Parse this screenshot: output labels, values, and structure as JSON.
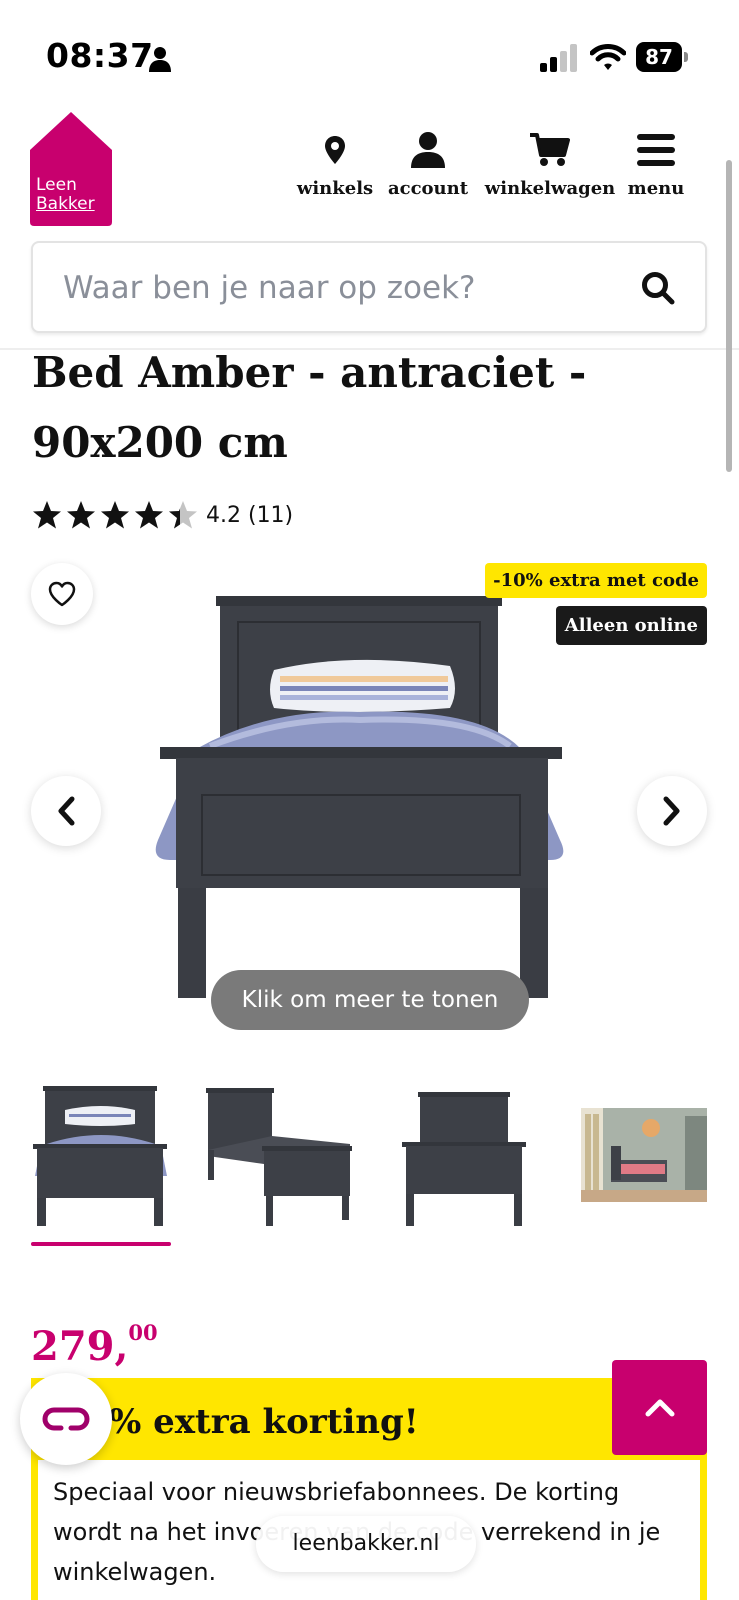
{
  "status_bar": {
    "time": "08:37",
    "battery": "87"
  },
  "header": {
    "logo_line1": "Leen",
    "logo_line2": "Bakker",
    "nav": [
      {
        "label": "winkels",
        "icon": "map-pin-icon"
      },
      {
        "label": "account",
        "icon": "user-icon"
      },
      {
        "label": "winkelwagen",
        "icon": "cart-icon"
      },
      {
        "label": "menu",
        "icon": "hamburger-menu-icon"
      }
    ],
    "search_placeholder": "Waar ben je naar op zoek?"
  },
  "product": {
    "title": "Bed Amber - antraciet - 90x200 cm",
    "rating": 4.2,
    "rating_text": "4.2 (11)",
    "stars_max": 5,
    "badges": {
      "promo": "-10% extra met code",
      "online": "Alleen online"
    },
    "gallery_button": "Klik om meer te tonen",
    "active_thumbnail": 0,
    "thumbnail_count": 4,
    "price_main": "279,",
    "price_cents": "00"
  },
  "promo_box": {
    "heading": "% extra korting!",
    "text": "Speciaal voor nieuwsbriefabonnees. De korting wordt na het invoeren van de code verrekend in je winkelwagen."
  },
  "browser": {
    "url": "leenbakker.nl"
  },
  "colors": {
    "brand": "#c8006e",
    "promo_yellow": "#ffe600",
    "bed": "#3d4047"
  }
}
